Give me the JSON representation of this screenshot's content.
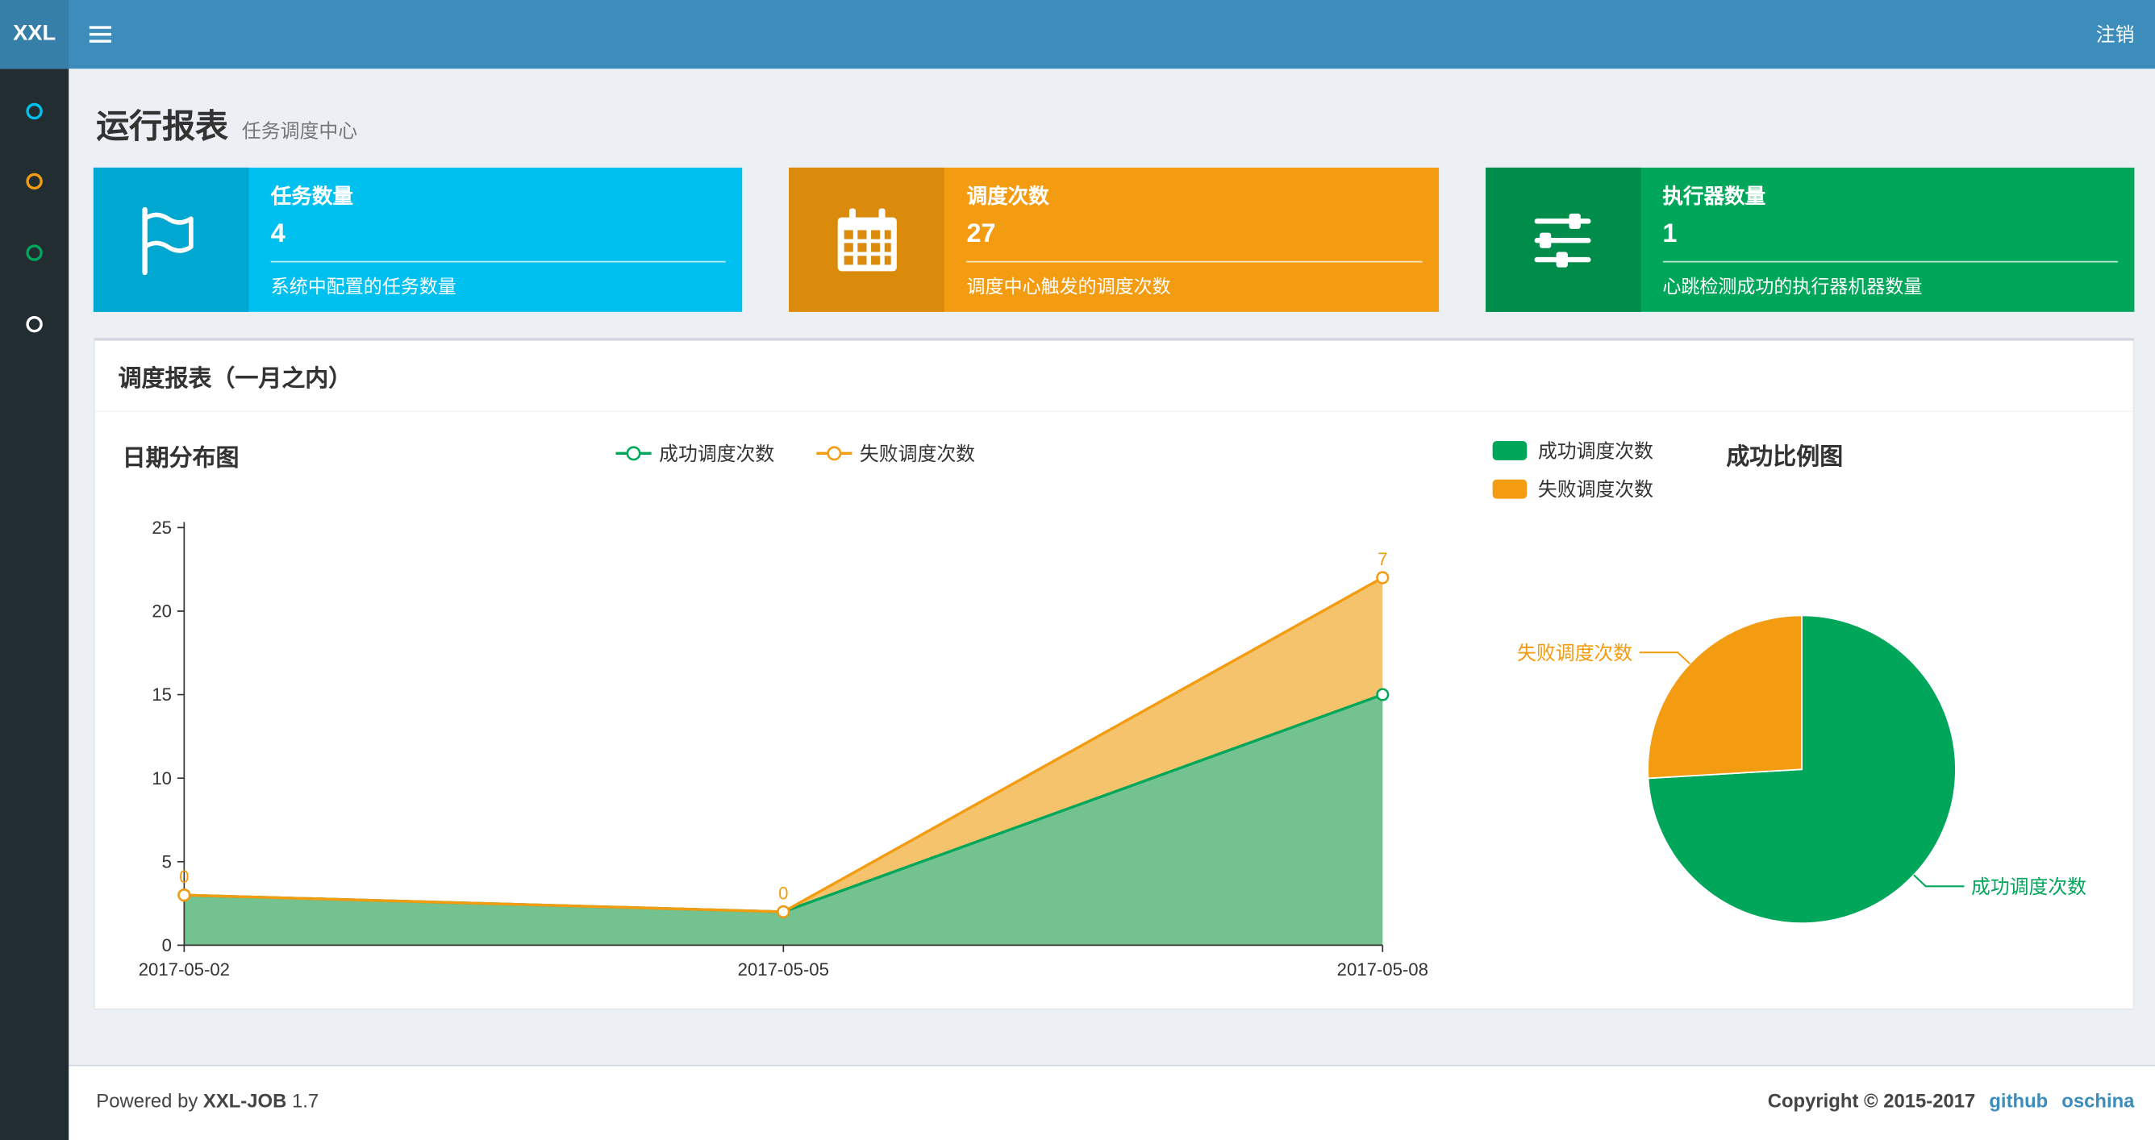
{
  "navbar": {
    "logo": "XXL",
    "logout": "注销"
  },
  "sidebar": {
    "items": [
      {
        "color": "#00c0ef"
      },
      {
        "color": "#f39c12"
      },
      {
        "color": "#00a65a"
      },
      {
        "color": "#ffffff"
      }
    ]
  },
  "header": {
    "title": "运行报表",
    "subtitle": "任务调度中心"
  },
  "info_boxes": [
    {
      "label": "任务数量",
      "value": "4",
      "desc": "系统中配置的任务数量",
      "color": "#00c0ef",
      "icon_bg": "#00a7d0",
      "icon": "flag-icon"
    },
    {
      "label": "调度次数",
      "value": "27",
      "desc": "调度中心触发的调度次数",
      "color": "#f39c12",
      "icon_bg": "#db8b0b",
      "icon": "calendar-icon"
    },
    {
      "label": "执行器数量",
      "value": "1",
      "desc": "心跳检测成功的执行器机器数量",
      "color": "#00a65a",
      "icon_bg": "#008d4c",
      "icon": "sliders-icon"
    }
  ],
  "panel": {
    "title": "调度报表（一月之内）"
  },
  "chart_data": [
    {
      "type": "area",
      "title": "日期分布图",
      "x": [
        "2017-05-02",
        "2017-05-05",
        "2017-05-08"
      ],
      "ylim": [
        0,
        25
      ],
      "yticks": [
        0,
        5,
        10,
        15,
        20,
        25
      ],
      "stacked": true,
      "grid": false,
      "legend_position": "top",
      "series": [
        {
          "name": "成功调度次数",
          "values": [
            3,
            2,
            15
          ],
          "color": "#00a65a",
          "fill": "#73c28f"
        },
        {
          "name": "失败调度次数",
          "values": [
            0,
            0,
            7
          ],
          "color": "#f39c12",
          "fill": "#f5c36b",
          "labels": [
            "0",
            "0",
            "7"
          ]
        }
      ]
    },
    {
      "type": "pie",
      "title": "成功比例图",
      "legend_position": "top-left",
      "slices": [
        {
          "name": "成功调度次数",
          "value": 20,
          "color": "#00a65a"
        },
        {
          "name": "失败调度次数",
          "value": 7,
          "color": "#f39c12"
        }
      ]
    }
  ],
  "footer": {
    "powered_prefix": "Powered by",
    "product": "XXL-JOB",
    "version": "1.7",
    "copyright": "Copyright © 2015-2017",
    "links": [
      {
        "label": "github"
      },
      {
        "label": "oschina"
      }
    ]
  }
}
